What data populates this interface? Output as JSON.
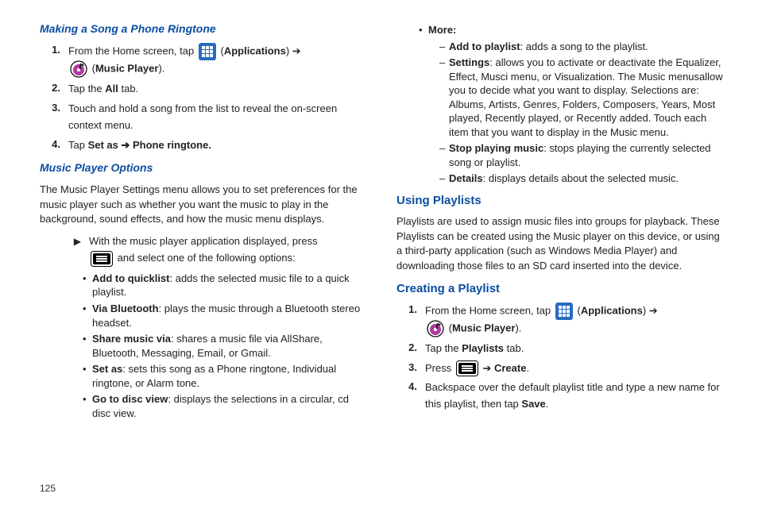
{
  "page_number": "125",
  "left": {
    "h1": "Making a Song a Phone Ringtone",
    "step1_a": "From the Home screen, tap ",
    "step1_b": " (",
    "step1_apps": "Applications",
    "step1_c": ") ➔ ",
    "step1_d": " (",
    "step1_music": "Music Player",
    "step1_e": ").",
    "step2_a": "Tap the ",
    "step2_all": "All",
    "step2_b": " tab.",
    "step3": "Touch and hold a song from the list to reveal the on-screen context menu.",
    "step4_a": "Tap ",
    "step4_set": "Set as ➔ Phone ringtone.",
    "h2": "Music Player Options",
    "options_intro": "The Music Player Settings menu allows you to set preferences for the music player such as whether you want the music to play in the background, sound effects, and how the music menu displays.",
    "arrow1": "With the music player application displayed, press ",
    "arrow2": " and select one of the following options:",
    "bul1_b": "Add to quicklist",
    "bul1_t": ": adds the selected music file to a quick playlist.",
    "bul2_b": "Via Bluetooth",
    "bul2_t": ": plays the music through a Bluetooth stereo headset.",
    "bul3_b": "Share music via",
    "bul3_t": ": shares a music file via AllShare, Bluetooth, Messaging, Email, or Gmail.",
    "bul4_b": "Set as",
    "bul4_t": ": sets this song as a Phone ringtone, Individual ringtone, or Alarm tone.",
    "bul5_b": "Go to disc view",
    "bul5_t": ": displays the selections in a circular, cd disc view."
  },
  "right": {
    "more_label": "More:",
    "d1_b": "Add to playlist",
    "d1_t": ": adds a song to the playlist.",
    "d2_b": "Settings",
    "d2_t": ": allows you to activate or deactivate the Equalizer, Effect, Musci menu, or Visualization. The Music menusallow you to decide what you want to display. Selections are: Albums, Artists, Genres, Folders, Composers, Years, Most played, Recently played, or Recently added. Touch each item that you want to display in the Music menu.",
    "d3_b": "Stop playing music",
    "d3_t": ": stops playing the currently selected song or playlist.",
    "d4_b": "Details",
    "d4_t": ": displays details about the selected music.",
    "h3": "Using Playlists",
    "playlists_intro": "Playlists are used to assign music files into groups for playback. These Playlists can be created using the Music player on this device, or using a third-party application (such as Windows Media Player) and downloading those files to an SD card inserted into the device.",
    "h4": "Creating a Playlist",
    "c1_a": "From the Home screen, tap ",
    "c1_b": " (",
    "c1_apps": "Applications",
    "c1_c": ") ➔ ",
    "c1_d": " (",
    "c1_music": "Music Player",
    "c1_e": ").",
    "c2_a": "Tap the ",
    "c2_pl": "Playlists",
    "c2_b": " tab.",
    "c3_a": "Press ",
    "c3_b": " ➔ ",
    "c3_create": "Create",
    "c3_c": ".",
    "c4_a": "Backspace over the default playlist title and type a new name for this playlist, then tap ",
    "c4_save": "Save",
    "c4_b": "."
  }
}
